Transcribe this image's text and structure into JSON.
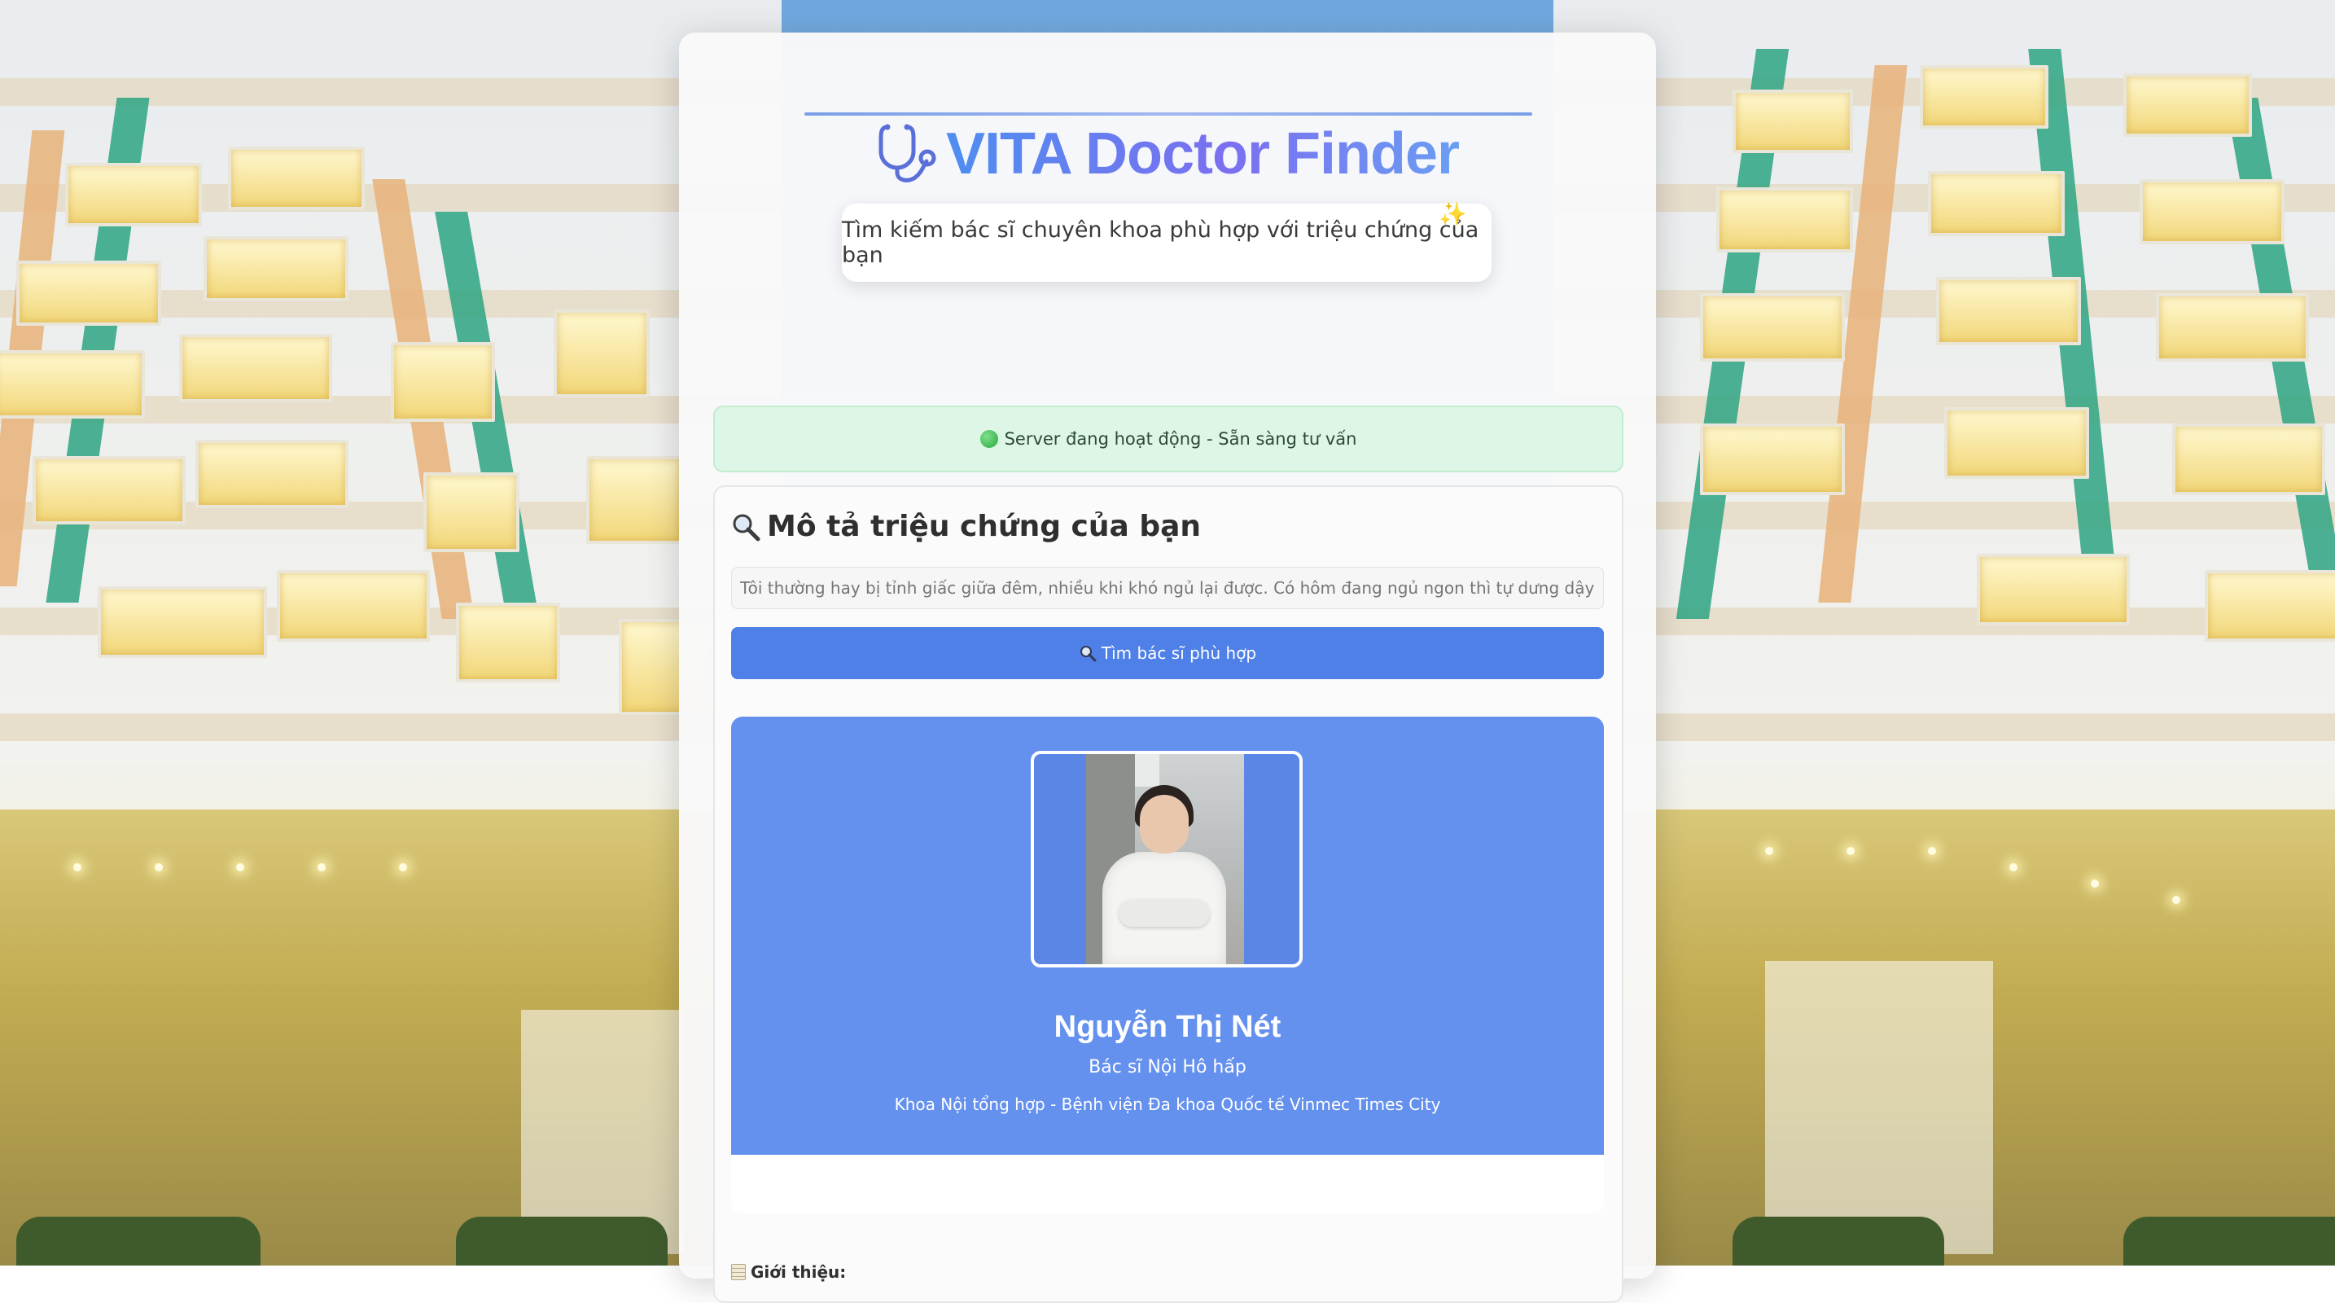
{
  "app": {
    "title": "VITA Doctor Finder",
    "subtitle": "Tìm kiếm bác sĩ chuyên khoa phù hợp với triệu chứng của bạn",
    "title_icon": "stethoscope-icon",
    "subtitle_icon": "sparkles-icon"
  },
  "status": {
    "icon": "green-circle-icon",
    "text": "Server đang hoạt động - Sẵn sàng tư vấn"
  },
  "search": {
    "section_icon": "magnifying-glass-icon",
    "section_title": "Mô tả triệu chứng của bạn",
    "input_placeholder": "Tôi thường hay bị tỉnh giấc giữa đêm, nhiều khi khó ngủ lại được. Có hôm đang ngủ ngon thì tự dưng dậy, rồi trằn trọc tới sáng",
    "button_icon": "magnifying-glass-icon",
    "button_label": "Tìm bác sĩ phù hợp"
  },
  "doctor": {
    "name": "Nguyễn Thị Nét",
    "role": "Bác sĩ Nội Hô hấp",
    "department": "Khoa Nội tổng hợp - Bệnh viện Đa khoa Quốc tế Vinmec Times City",
    "intro_icon": "notepad-icon",
    "intro_label": "Giới thiệu:"
  },
  "colors": {
    "accent_blue": "#4f80e8",
    "card_blue": "#6490ee",
    "title_gradient_start": "#4f8ef0",
    "title_gradient_end": "#7b6ff0",
    "status_bg": "#ddf6e6"
  }
}
